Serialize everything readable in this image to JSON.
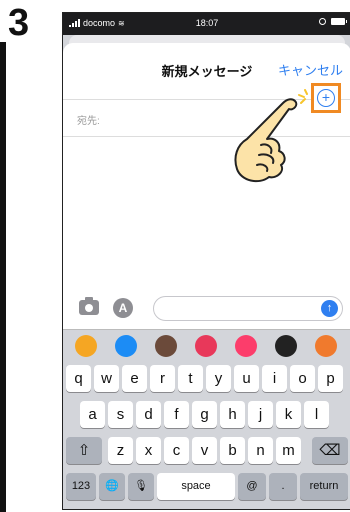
{
  "step_number": "3",
  "status_bar": {
    "carrier": "docomo",
    "time": "18:07"
  },
  "header": {
    "title": "新規メッセージ",
    "cancel_label": "キャンセル"
  },
  "to_field": {
    "label": "宛先:",
    "add_button_symbol": "+"
  },
  "input_bar": {
    "appstore_symbol": "A",
    "send_symbol": "↑"
  },
  "app_strip": [
    {
      "name": "photos-app-icon",
      "color": "#f5a623"
    },
    {
      "name": "appstore-app-icon",
      "color": "#1c8cf5"
    },
    {
      "name": "memoji-app-icon",
      "color": "#6b4a3a"
    },
    {
      "name": "images-search-app-icon",
      "color": "#e8385a"
    },
    {
      "name": "music-app-icon",
      "color": "#fc3d6b"
    },
    {
      "name": "digital-touch-app-icon",
      "color": "#222222"
    },
    {
      "name": "more-app-icon",
      "color": "#f07a2d"
    }
  ],
  "keyboard": {
    "row1": [
      "q",
      "w",
      "e",
      "r",
      "t",
      "y",
      "u",
      "i",
      "o",
      "p"
    ],
    "row2": [
      "a",
      "s",
      "d",
      "f",
      "g",
      "h",
      "j",
      "k",
      "l"
    ],
    "row3": [
      "z",
      "x",
      "c",
      "v",
      "b",
      "n",
      "m"
    ],
    "shift": "⇧",
    "delete": "⌫",
    "numbers": "123",
    "globe": "🌐",
    "mic": "🎙",
    "space": "space",
    "at": "@",
    "dot": ".",
    "return": "return"
  },
  "colors": {
    "accent": "#2f7ff0",
    "highlight": "#f08a23"
  }
}
